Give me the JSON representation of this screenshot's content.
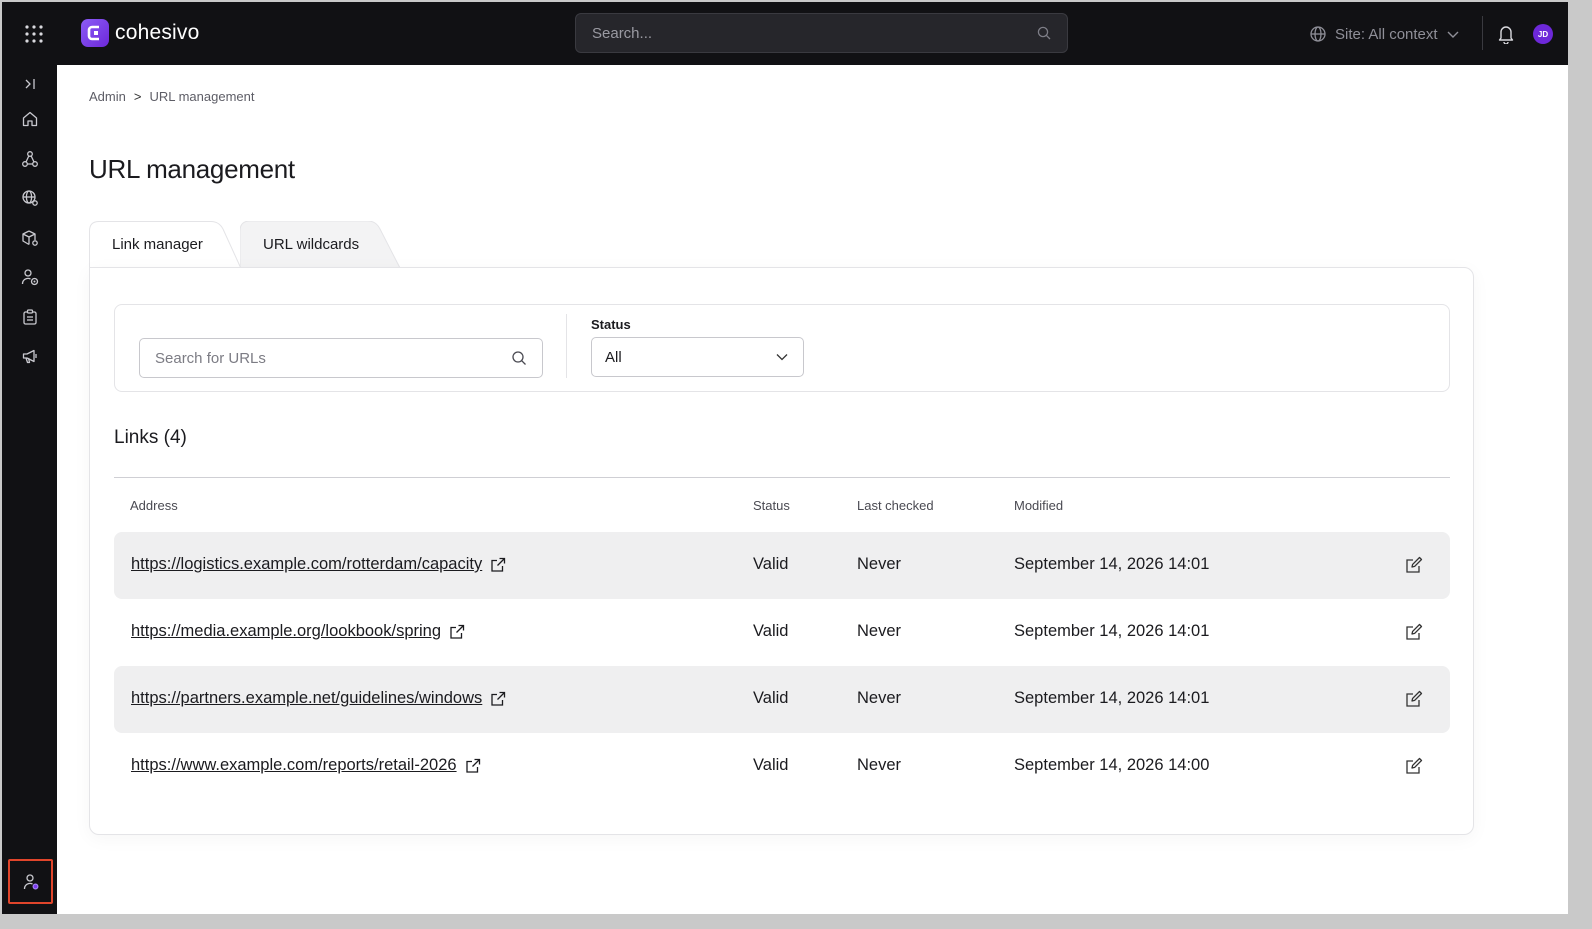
{
  "app": {
    "brand": "cohesivo",
    "accent": "#7c3aed"
  },
  "topbar": {
    "search_placeholder": "Search...",
    "site_context": "Site: All context",
    "avatar_initials": "JD"
  },
  "breadcrumb": {
    "parent": "Admin",
    "separator": ">",
    "current": "URL management"
  },
  "page": {
    "title": "URL management"
  },
  "tabs": [
    {
      "label": "Link manager",
      "active": true
    },
    {
      "label": "URL wildcards",
      "active": false
    }
  ],
  "filters": {
    "search_placeholder": "Search for URLs",
    "status_label": "Status",
    "status_value": "All"
  },
  "links": {
    "heading": "Links (4)",
    "columns": [
      "Address",
      "Status",
      "Last checked",
      "Modified"
    ],
    "rows": [
      {
        "address": "https://logistics.example.com/rotterdam/capacity",
        "status": "Valid",
        "last_checked": "Never",
        "modified": "September 14, 2026 14:01"
      },
      {
        "address": "https://media.example.org/lookbook/spring",
        "status": "Valid",
        "last_checked": "Never",
        "modified": "September 14, 2026 14:01"
      },
      {
        "address": "https://partners.example.net/guidelines/windows",
        "status": "Valid",
        "last_checked": "Never",
        "modified": "September 14, 2026 14:01"
      },
      {
        "address": "https://www.example.com/reports/retail-2026",
        "status": "Valid",
        "last_checked": "Never",
        "modified": "September 14, 2026 14:00"
      }
    ]
  },
  "sidebar": {
    "items": [
      {
        "icon": "expand-sidebar-icon"
      },
      {
        "icon": "home-icon"
      },
      {
        "icon": "structure-icon"
      },
      {
        "icon": "globe-settings-icon"
      },
      {
        "icon": "package-settings-icon"
      },
      {
        "icon": "user-target-icon"
      },
      {
        "icon": "clipboard-icon"
      },
      {
        "icon": "megaphone-icon"
      },
      {
        "icon": "user-settings-icon",
        "active": true
      }
    ]
  }
}
